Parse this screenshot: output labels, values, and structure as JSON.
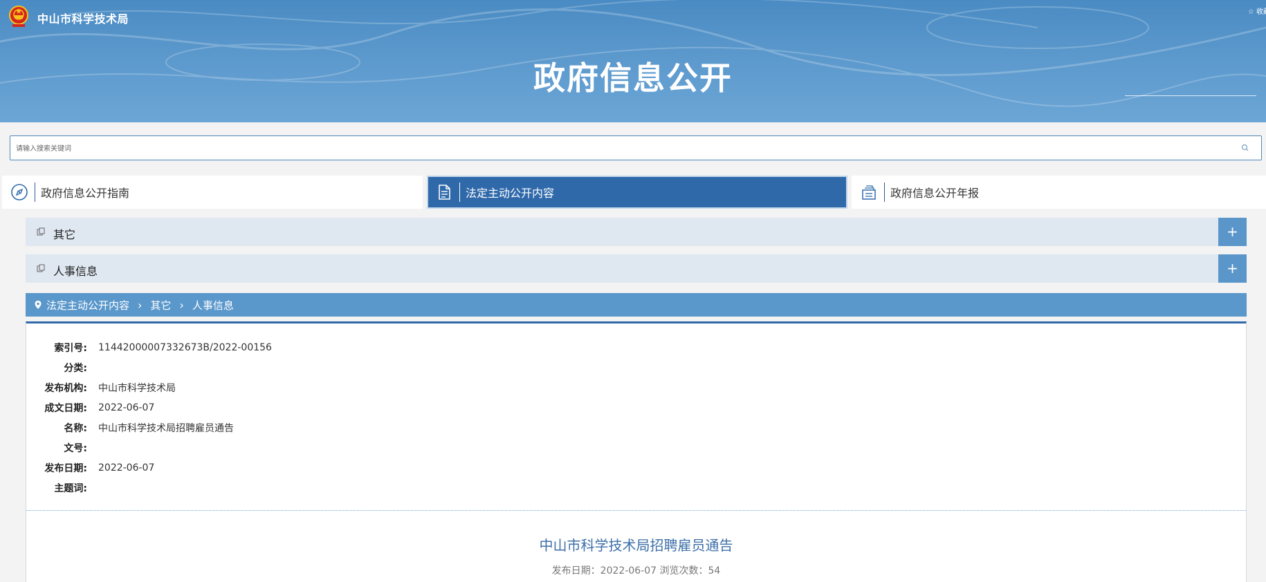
{
  "header": {
    "site_name": "中山市科学技术局",
    "favorite": "☆ 收藏",
    "title": "政府信息公开"
  },
  "search": {
    "placeholder": "请输入搜索关键词",
    "icon": "search-icon"
  },
  "tabs": [
    {
      "label": "政府信息公开指南",
      "icon": "compass-icon",
      "active": false
    },
    {
      "label": "法定主动公开内容",
      "icon": "document-icon",
      "active": true
    },
    {
      "label": "政府信息公开年报",
      "icon": "folder-docs-icon",
      "active": false
    }
  ],
  "categories": [
    {
      "label": "其它",
      "expand": "+"
    },
    {
      "label": "人事信息",
      "expand": "+"
    }
  ],
  "breadcrumb": {
    "items": [
      "法定主动公开内容",
      "其它",
      "人事信息"
    ]
  },
  "meta": [
    {
      "label": "索引号:",
      "value": "11442000007332673B/2022-00156"
    },
    {
      "label": "分类:",
      "value": ""
    },
    {
      "label": "发布机构:",
      "value": "中山市科学技术局"
    },
    {
      "label": "成文日期:",
      "value": "2022-06-07"
    },
    {
      "label": "名称:",
      "value": "中山市科学技术局招聘雇员通告"
    },
    {
      "label": "文号:",
      "value": ""
    },
    {
      "label": "发布日期:",
      "value": "2022-06-07"
    },
    {
      "label": "主题词:",
      "value": ""
    }
  ],
  "document": {
    "title": "中山市科学技术局招聘雇员通告",
    "info": "发布日期：2022-06-07  浏览次数：54"
  },
  "colors": {
    "header_blue": "#4a8bc3",
    "active_tab": "#2f69aa",
    "breadcrumb_bar": "#5a97cb",
    "category_bg": "#dfe7f0",
    "doc_title": "#3d6fa8"
  }
}
